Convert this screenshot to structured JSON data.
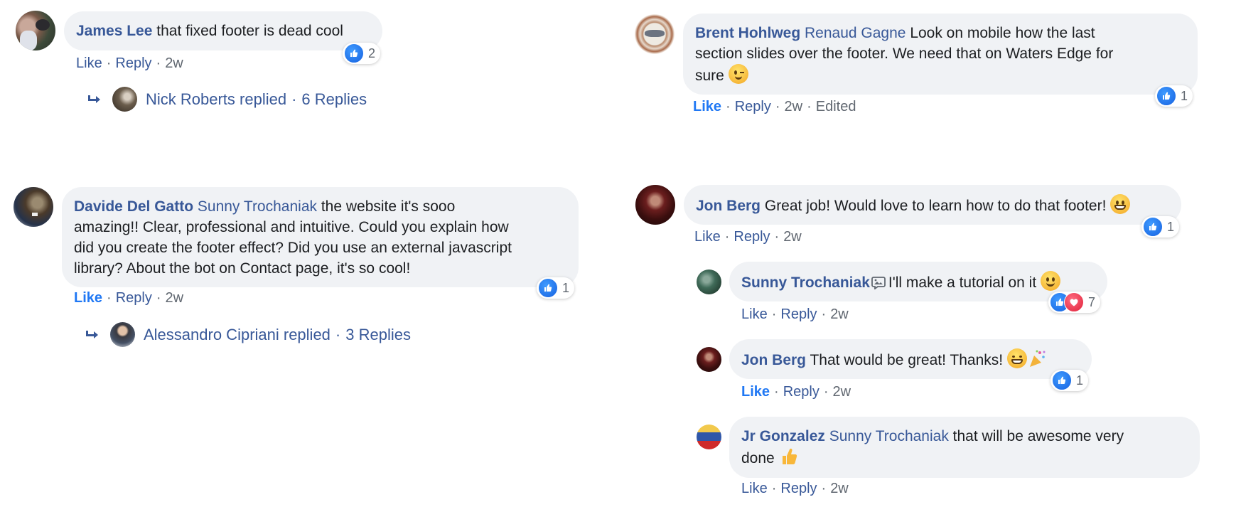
{
  "colors": {
    "bubble": "#f0f2f5",
    "link": "#385898",
    "like_active": "#2078f4",
    "meta": "#606770",
    "like_reaction": "#1877f2",
    "love_reaction": "#e0213a"
  },
  "actions": {
    "like": "Like",
    "reply": "Reply",
    "sep": "·"
  },
  "comments": [
    {
      "author": "James Lee",
      "mention": "",
      "text": "that fixed footer is dead cool",
      "time": "2w",
      "like_active": false,
      "reactions": {
        "types": [
          "like-icon"
        ],
        "count": "2"
      },
      "replied": {
        "name": "Nick Roberts replied",
        "sep": "·",
        "count": "6 Replies"
      }
    },
    {
      "author": "Brent Hohlweg",
      "mention": "Renaud Gagne",
      "text_line1": "Look on mobile how the last",
      "text_line2": "section slides over the footer. We need that on Waters Edge for",
      "text_line3": "sure",
      "emoji": "winking-face-emoji",
      "time": "2w",
      "edited": "Edited",
      "like_active": true,
      "reactions": {
        "types": [
          "like-icon"
        ],
        "count": "1"
      }
    },
    {
      "author": "Davide Del Gatto",
      "mention": "Sunny Trochaniak",
      "text_line1": "the website it's sooo",
      "text_line2": "amazing!! Clear, professional and intuitive. Could you explain how",
      "text_line3": "did you create the footer effect? Did you use an external javascript",
      "text_line4": "library? About the bot on Contact page, it's so cool!",
      "time": "2w",
      "like_active": true,
      "reactions": {
        "types": [
          "like-icon"
        ],
        "count": "1"
      },
      "replied": {
        "name": "Alessandro Cipriani replied",
        "sep": "·",
        "count": "3 Replies"
      }
    },
    {
      "author": "Jon Berg",
      "mention": "",
      "text": "Great job! Would love to learn how to do that footer!",
      "emoji": "grinning-face-emoji",
      "time": "2w",
      "like_active": false,
      "reactions": {
        "types": [
          "like-icon"
        ],
        "count": "1"
      },
      "replies": [
        {
          "author": "Sunny Trochaniak",
          "inline_icon": "picture-chat-icon",
          "text": "I'll make a tutorial on it",
          "emoji": "smiling-face-emoji",
          "time": "2w",
          "like_active": false,
          "reactions": {
            "types": [
              "like-icon",
              "love-icon"
            ],
            "count": "7"
          }
        },
        {
          "author": "Jon Berg",
          "text": "That would be great! Thanks!",
          "emoji": "beaming-face-emoji",
          "emoji2": "party-popper-emoji",
          "time": "2w",
          "like_active": true,
          "reactions": {
            "types": [
              "like-icon"
            ],
            "count": "1"
          }
        },
        {
          "author": "Jr Gonzalez",
          "mention": "Sunny Trochaniak",
          "text_line1": "that will be awesome very",
          "text_line2": "done",
          "emoji": "thumbs-up-emoji",
          "time": "2w",
          "like_active": false
        }
      ]
    }
  ]
}
